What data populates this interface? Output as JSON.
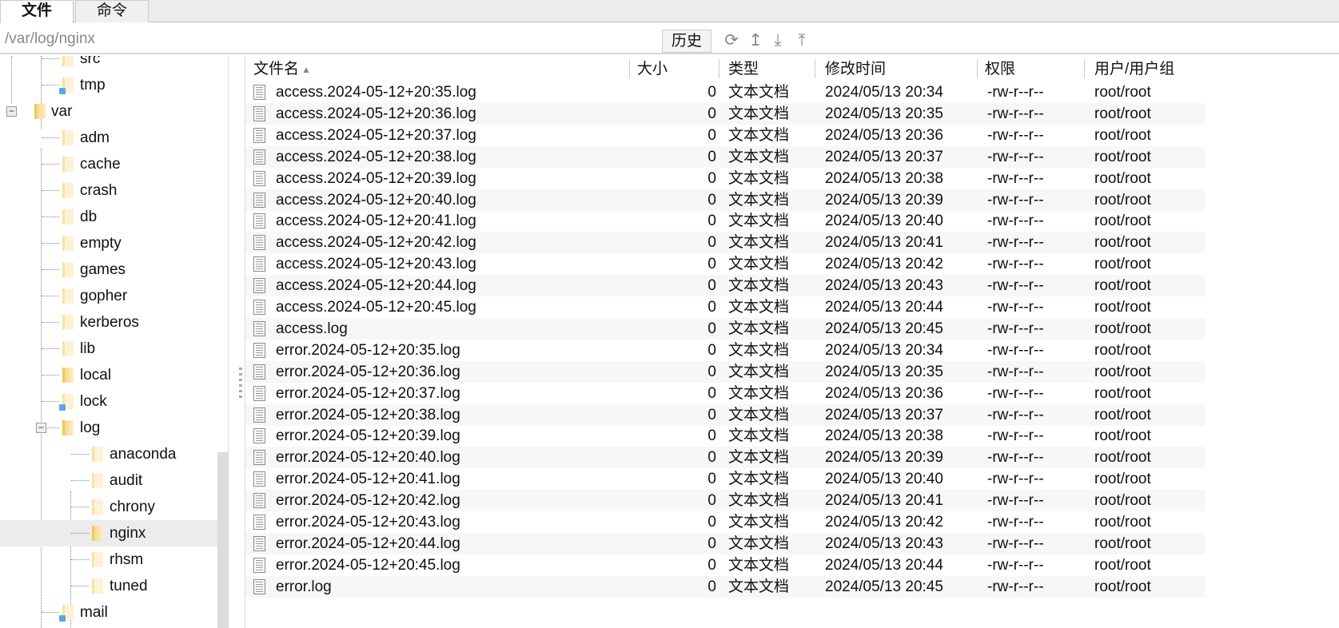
{
  "tabs": [
    {
      "label": "文件",
      "active": true
    },
    {
      "label": "命令",
      "active": false
    }
  ],
  "pathbar": {
    "path": "/var/log/nginx",
    "history_label": "历史",
    "icons": [
      "refresh-icon",
      "up-arrow-icon",
      "download-icon",
      "upload-icon"
    ]
  },
  "tree": [
    {
      "label": "src",
      "level": 1,
      "link": false,
      "faded": true
    },
    {
      "label": "tmp",
      "level": 1,
      "link": true,
      "faded": true
    },
    {
      "label": "var",
      "level": 0,
      "expanded": true
    },
    {
      "label": "adm",
      "level": 1,
      "faded": true
    },
    {
      "label": "cache",
      "level": 1,
      "faded": true
    },
    {
      "label": "crash",
      "level": 1,
      "faded": true
    },
    {
      "label": "db",
      "level": 1,
      "faded": true
    },
    {
      "label": "empty",
      "level": 1,
      "faded": true
    },
    {
      "label": "games",
      "level": 1,
      "faded": true
    },
    {
      "label": "gopher",
      "level": 1,
      "faded": true
    },
    {
      "label": "kerberos",
      "level": 1,
      "faded": true
    },
    {
      "label": "lib",
      "level": 1,
      "faded": true
    },
    {
      "label": "local",
      "level": 1
    },
    {
      "label": "lock",
      "level": 1,
      "link": true,
      "faded": true
    },
    {
      "label": "log",
      "level": 1,
      "expanded": true
    },
    {
      "label": "anaconda",
      "level": 2,
      "faded": true
    },
    {
      "label": "audit",
      "level": 2,
      "faded": true
    },
    {
      "label": "chrony",
      "level": 2,
      "faded": true
    },
    {
      "label": "nginx",
      "level": 2,
      "selected": true
    },
    {
      "label": "rhsm",
      "level": 2,
      "faded": true
    },
    {
      "label": "tuned",
      "level": 2,
      "faded": true
    },
    {
      "label": "mail",
      "level": 1,
      "link": true,
      "faded": true
    }
  ],
  "columns": {
    "name": "文件名",
    "size": "大小",
    "type": "类型",
    "mtime": "修改时间",
    "perm": "权限",
    "owner": "用户/用户组"
  },
  "files": [
    {
      "name": "access.2024-05-12+20:35.log",
      "size": "0",
      "type": "文本文档",
      "mtime": "2024/05/13 20:34",
      "perm": "-rw-r--r--",
      "owner": "root/root"
    },
    {
      "name": "access.2024-05-12+20:36.log",
      "size": "0",
      "type": "文本文档",
      "mtime": "2024/05/13 20:35",
      "perm": "-rw-r--r--",
      "owner": "root/root"
    },
    {
      "name": "access.2024-05-12+20:37.log",
      "size": "0",
      "type": "文本文档",
      "mtime": "2024/05/13 20:36",
      "perm": "-rw-r--r--",
      "owner": "root/root"
    },
    {
      "name": "access.2024-05-12+20:38.log",
      "size": "0",
      "type": "文本文档",
      "mtime": "2024/05/13 20:37",
      "perm": "-rw-r--r--",
      "owner": "root/root"
    },
    {
      "name": "access.2024-05-12+20:39.log",
      "size": "0",
      "type": "文本文档",
      "mtime": "2024/05/13 20:38",
      "perm": "-rw-r--r--",
      "owner": "root/root"
    },
    {
      "name": "access.2024-05-12+20:40.log",
      "size": "0",
      "type": "文本文档",
      "mtime": "2024/05/13 20:39",
      "perm": "-rw-r--r--",
      "owner": "root/root"
    },
    {
      "name": "access.2024-05-12+20:41.log",
      "size": "0",
      "type": "文本文档",
      "mtime": "2024/05/13 20:40",
      "perm": "-rw-r--r--",
      "owner": "root/root"
    },
    {
      "name": "access.2024-05-12+20:42.log",
      "size": "0",
      "type": "文本文档",
      "mtime": "2024/05/13 20:41",
      "perm": "-rw-r--r--",
      "owner": "root/root"
    },
    {
      "name": "access.2024-05-12+20:43.log",
      "size": "0",
      "type": "文本文档",
      "mtime": "2024/05/13 20:42",
      "perm": "-rw-r--r--",
      "owner": "root/root"
    },
    {
      "name": "access.2024-05-12+20:44.log",
      "size": "0",
      "type": "文本文档",
      "mtime": "2024/05/13 20:43",
      "perm": "-rw-r--r--",
      "owner": "root/root"
    },
    {
      "name": "access.2024-05-12+20:45.log",
      "size": "0",
      "type": "文本文档",
      "mtime": "2024/05/13 20:44",
      "perm": "-rw-r--r--",
      "owner": "root/root"
    },
    {
      "name": "access.log",
      "size": "0",
      "type": "文本文档",
      "mtime": "2024/05/13 20:45",
      "perm": "-rw-r--r--",
      "owner": "root/root"
    },
    {
      "name": "error.2024-05-12+20:35.log",
      "size": "0",
      "type": "文本文档",
      "mtime": "2024/05/13 20:34",
      "perm": "-rw-r--r--",
      "owner": "root/root"
    },
    {
      "name": "error.2024-05-12+20:36.log",
      "size": "0",
      "type": "文本文档",
      "mtime": "2024/05/13 20:35",
      "perm": "-rw-r--r--",
      "owner": "root/root"
    },
    {
      "name": "error.2024-05-12+20:37.log",
      "size": "0",
      "type": "文本文档",
      "mtime": "2024/05/13 20:36",
      "perm": "-rw-r--r--",
      "owner": "root/root"
    },
    {
      "name": "error.2024-05-12+20:38.log",
      "size": "0",
      "type": "文本文档",
      "mtime": "2024/05/13 20:37",
      "perm": "-rw-r--r--",
      "owner": "root/root"
    },
    {
      "name": "error.2024-05-12+20:39.log",
      "size": "0",
      "type": "文本文档",
      "mtime": "2024/05/13 20:38",
      "perm": "-rw-r--r--",
      "owner": "root/root"
    },
    {
      "name": "error.2024-05-12+20:40.log",
      "size": "0",
      "type": "文本文档",
      "mtime": "2024/05/13 20:39",
      "perm": "-rw-r--r--",
      "owner": "root/root"
    },
    {
      "name": "error.2024-05-12+20:41.log",
      "size": "0",
      "type": "文本文档",
      "mtime": "2024/05/13 20:40",
      "perm": "-rw-r--r--",
      "owner": "root/root"
    },
    {
      "name": "error.2024-05-12+20:42.log",
      "size": "0",
      "type": "文本文档",
      "mtime": "2024/05/13 20:41",
      "perm": "-rw-r--r--",
      "owner": "root/root"
    },
    {
      "name": "error.2024-05-12+20:43.log",
      "size": "0",
      "type": "文本文档",
      "mtime": "2024/05/13 20:42",
      "perm": "-rw-r--r--",
      "owner": "root/root"
    },
    {
      "name": "error.2024-05-12+20:44.log",
      "size": "0",
      "type": "文本文档",
      "mtime": "2024/05/13 20:43",
      "perm": "-rw-r--r--",
      "owner": "root/root"
    },
    {
      "name": "error.2024-05-12+20:45.log",
      "size": "0",
      "type": "文本文档",
      "mtime": "2024/05/13 20:44",
      "perm": "-rw-r--r--",
      "owner": "root/root"
    },
    {
      "name": "error.log",
      "size": "0",
      "type": "文本文档",
      "mtime": "2024/05/13 20:45",
      "perm": "-rw-r--r--",
      "owner": "root/root"
    }
  ]
}
